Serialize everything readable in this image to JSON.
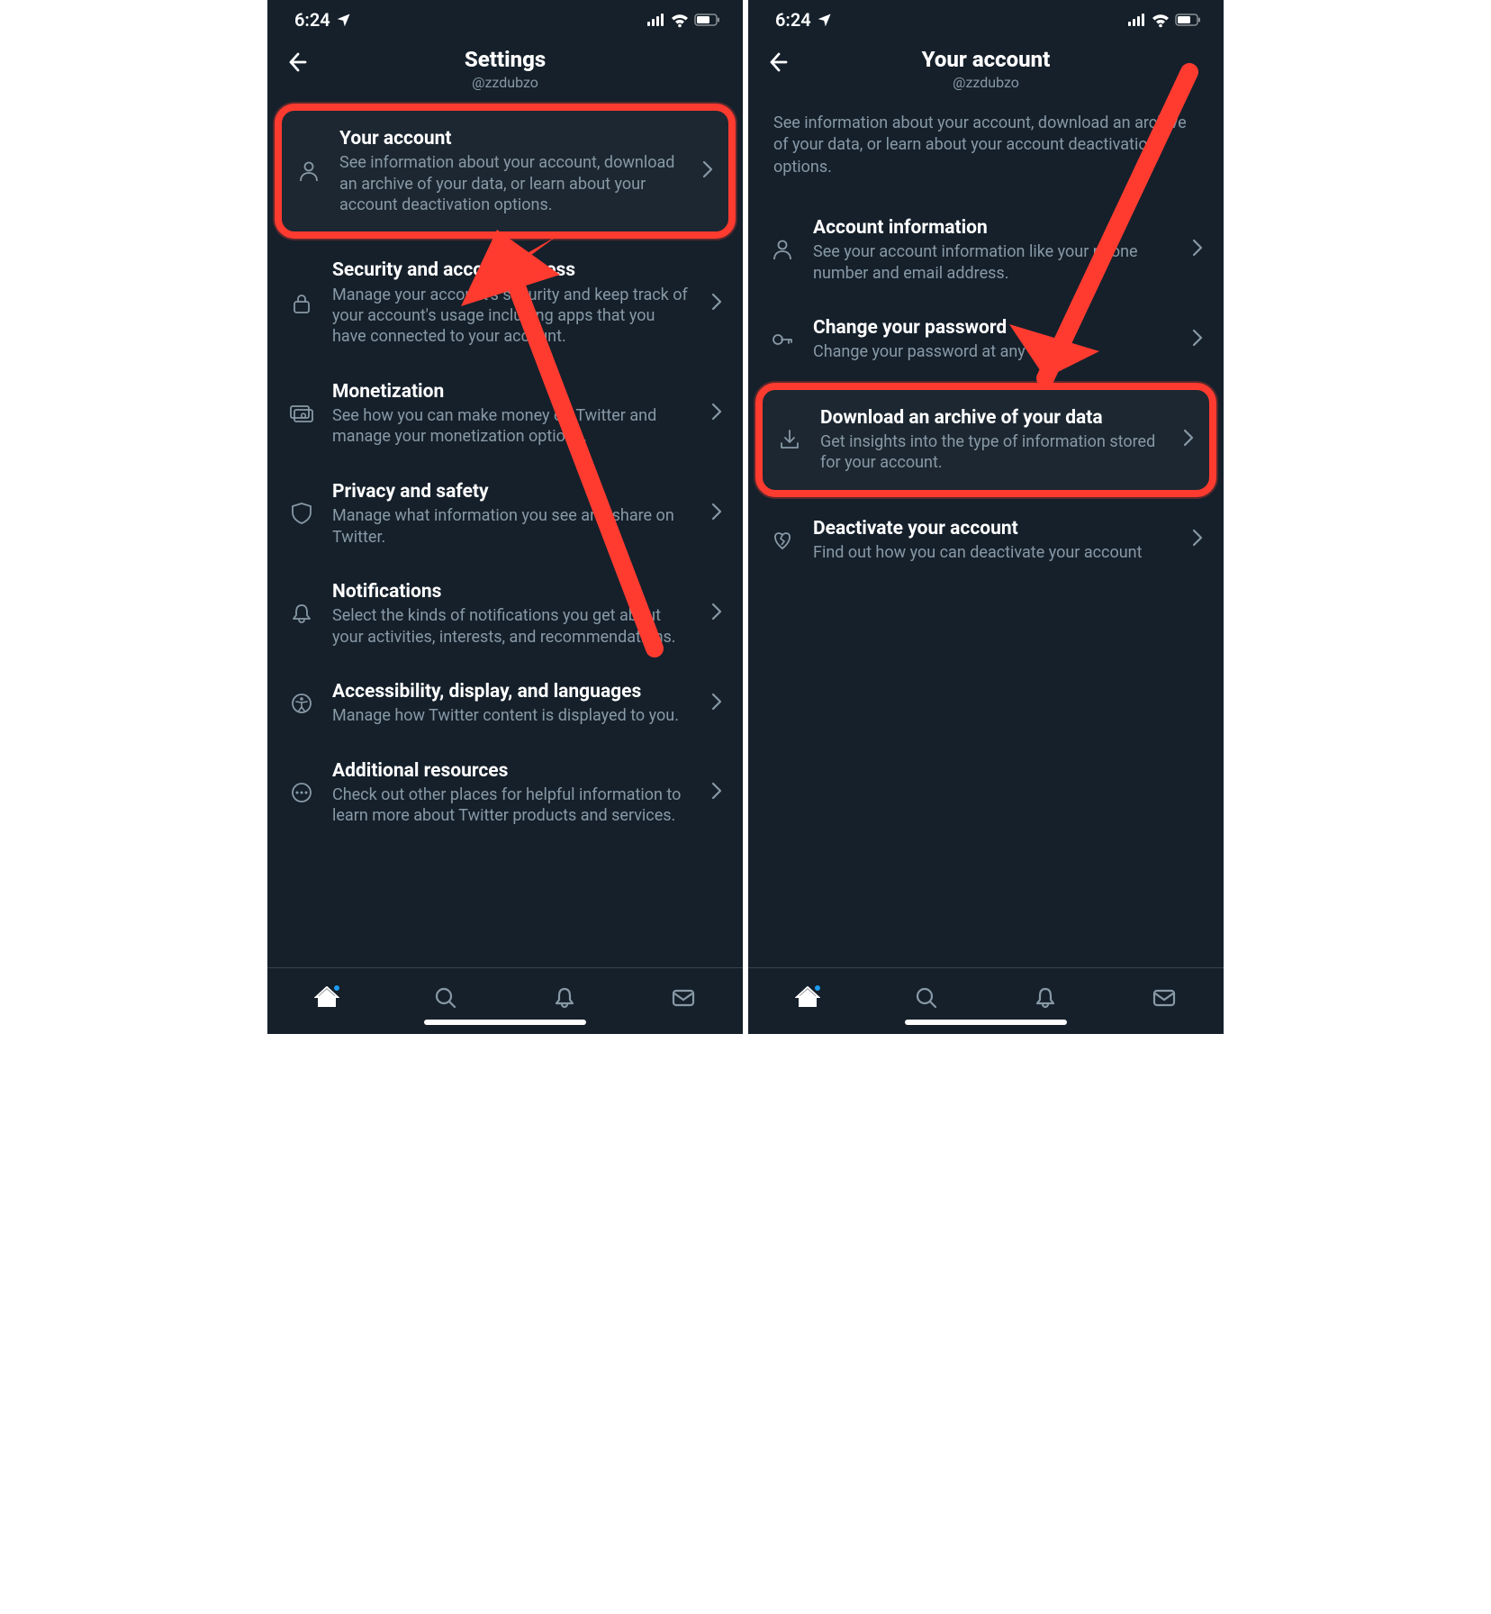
{
  "status": {
    "time": "6:24"
  },
  "left": {
    "header": {
      "title": "Settings",
      "subtitle": "@zzdubzo"
    },
    "items": [
      {
        "label": "Your account",
        "desc": "See information about your account, download an archive of your data, or learn about your account deactivation options."
      },
      {
        "label": "Security and account access",
        "desc": "Manage your account's security and keep track of your account's usage including apps that you have connected to your account."
      },
      {
        "label": "Monetization",
        "desc": "See how you can make money on Twitter and manage your monetization options."
      },
      {
        "label": "Privacy and safety",
        "desc": "Manage what information you see and share on Twitter."
      },
      {
        "label": "Notifications",
        "desc": "Select the kinds of notifications you get about your activities, interests, and recommendations."
      },
      {
        "label": "Accessibility, display, and languages",
        "desc": "Manage how Twitter content is displayed to you."
      },
      {
        "label": "Additional resources",
        "desc": "Check out other places for helpful information to learn more about Twitter products and services."
      }
    ]
  },
  "right": {
    "header": {
      "title": "Your account",
      "subtitle": "@zzdubzo"
    },
    "intro": "See information about your account, download an archive of your data, or learn about your account deactivation options.",
    "items": [
      {
        "label": "Account information",
        "desc": "See your account information like your phone number and email address."
      },
      {
        "label": "Change your password",
        "desc": "Change your password at any time."
      },
      {
        "label": "Download an archive of your data",
        "desc": "Get insights into the type of information stored for your account."
      },
      {
        "label": "Deactivate your account",
        "desc": "Find out how you can deactivate your account"
      }
    ]
  },
  "colors": {
    "highlight": "#ff3b30",
    "accent": "#1d9bf0"
  }
}
